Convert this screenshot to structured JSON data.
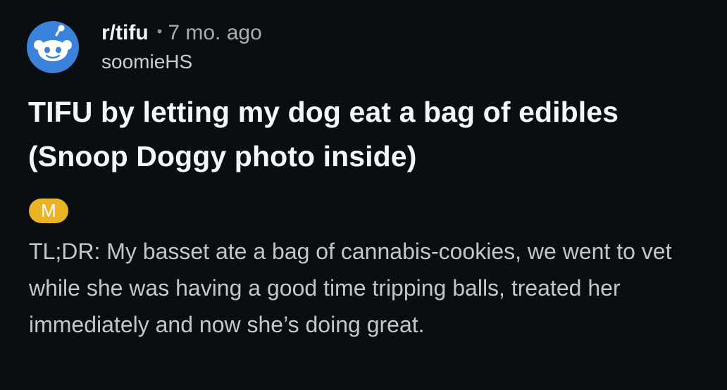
{
  "post": {
    "subreddit": "r/tifu",
    "separator": "•",
    "time": "7 mo. ago",
    "username": "soomieHS",
    "title": "TIFU by letting my dog eat a bag of edibles (Snoop Doggy photo inside)",
    "flair": "M",
    "body": "TL;DR: My basset ate a bag of cannabis-cookies, we went to vet while she was having a good time tripping balls, treated her immediately and now she’s doing great."
  },
  "icons": {
    "avatar": "reddit-snoo-icon"
  },
  "colors": {
    "background": "#0b0e11",
    "avatar": "#3b82db",
    "flair": "#e8b325",
    "title": "#f5f6f7",
    "body": "#c1c7cd"
  }
}
